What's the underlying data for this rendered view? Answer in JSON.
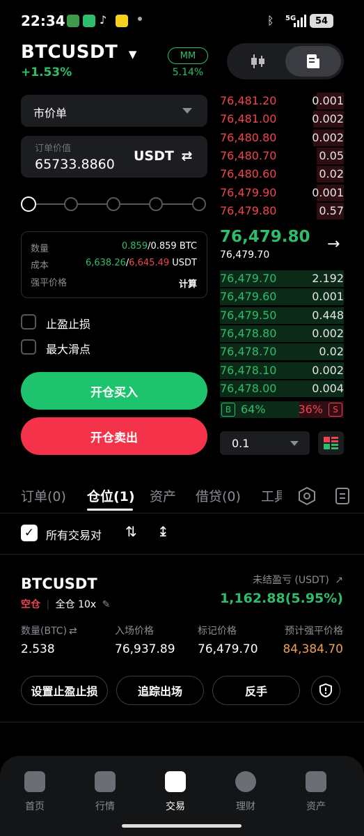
{
  "status_bar": {
    "time": "22:34",
    "battery": "54",
    "network": "5G"
  },
  "header": {
    "pair": "BTCUSDT",
    "change": "+1.53%",
    "mm_label": "MM",
    "mm_value": "5.14%"
  },
  "order_form": {
    "order_type": "市价单",
    "price_placeholder": "订单价值",
    "price_value": "65733.8860",
    "price_unit": "USDT",
    "slider_percent": 0,
    "info": {
      "qty_label": "数量",
      "qty_value_green": "0.859",
      "qty_value_rest": "/0.859 BTC",
      "cost_label": "成本",
      "cost_value_green": "6,638.26",
      "cost_sep": "/",
      "cost_value_red": "6,645.49",
      "cost_unit": " USDT",
      "liq_label": "强平价格",
      "liq_action": "计算"
    },
    "tp_sl_label": "止盈止损",
    "slippage_label": "最大滑点",
    "buy_label": "开仓买入",
    "sell_label": "开仓卖出"
  },
  "orderbook": {
    "asks": [
      {
        "price": "76,481.20",
        "qty": "0.001",
        "depth": 0.22
      },
      {
        "price": "76,481.00",
        "qty": "0.002",
        "depth": 0.25
      },
      {
        "price": "76,480.80",
        "qty": "0.002",
        "depth": 0.25
      },
      {
        "price": "76,480.70",
        "qty": "0.05",
        "depth": 0.22
      },
      {
        "price": "76,480.60",
        "qty": "0.02",
        "depth": 0.22
      },
      {
        "price": "76,479.90",
        "qty": "0.001",
        "depth": 0.22
      },
      {
        "price": "76,479.80",
        "qty": "0.57",
        "depth": 0.22
      }
    ],
    "last_price": "76,479.80",
    "mark_price": "76,479.70",
    "bids": [
      {
        "price": "76,479.70",
        "qty": "2.192",
        "depth": 1.0
      },
      {
        "price": "76,479.60",
        "qty": "0.001",
        "depth": 1.0
      },
      {
        "price": "76,479.50",
        "qty": "0.448",
        "depth": 1.0
      },
      {
        "price": "76,478.80",
        "qty": "0.002",
        "depth": 1.0
      },
      {
        "price": "76,478.70",
        "qty": "0.02",
        "depth": 1.0
      },
      {
        "price": "76,478.10",
        "qty": "0.002",
        "depth": 1.0
      },
      {
        "price": "76,478.00",
        "qty": "0.004",
        "depth": 1.0
      }
    ],
    "buy_badge": "B",
    "buy_ratio": "64%",
    "sell_ratio": "36%",
    "sell_badge": "S",
    "depth_step": "0.1"
  },
  "tabs": [
    "订单(0)",
    "仓位(1)",
    "资产",
    "借贷(0)",
    "工具"
  ],
  "filter": {
    "all_pairs_label": "所有交易对"
  },
  "position": {
    "symbol": "BTCUSDT",
    "side": "空仓",
    "margin_mode": "全仓 10x",
    "pnl_label": "未结盈亏 (USDT)",
    "pnl_value": "1,162.88(5.95%)",
    "stats": [
      {
        "label": "数量(BTC)",
        "value": "2.538"
      },
      {
        "label": "入场价格",
        "value": "76,937.89"
      },
      {
        "label": "标记价格",
        "value": "76,479.70"
      },
      {
        "label": "预计强平价格",
        "value": "84,384.70"
      }
    ],
    "actions": [
      "设置止盈止损",
      "追踪出场",
      "反手"
    ]
  },
  "bottom_nav": [
    {
      "label": "首页",
      "icon": "home-icon"
    },
    {
      "label": "行情",
      "icon": "chart-icon"
    },
    {
      "label": "交易",
      "icon": "trade-icon"
    },
    {
      "label": "理财",
      "icon": "percent-icon"
    },
    {
      "label": "资产",
      "icon": "wallet-icon"
    }
  ],
  "colors": {
    "buy": "#1ec46d",
    "sell": "#f4334a",
    "liq": "#f0a050"
  }
}
